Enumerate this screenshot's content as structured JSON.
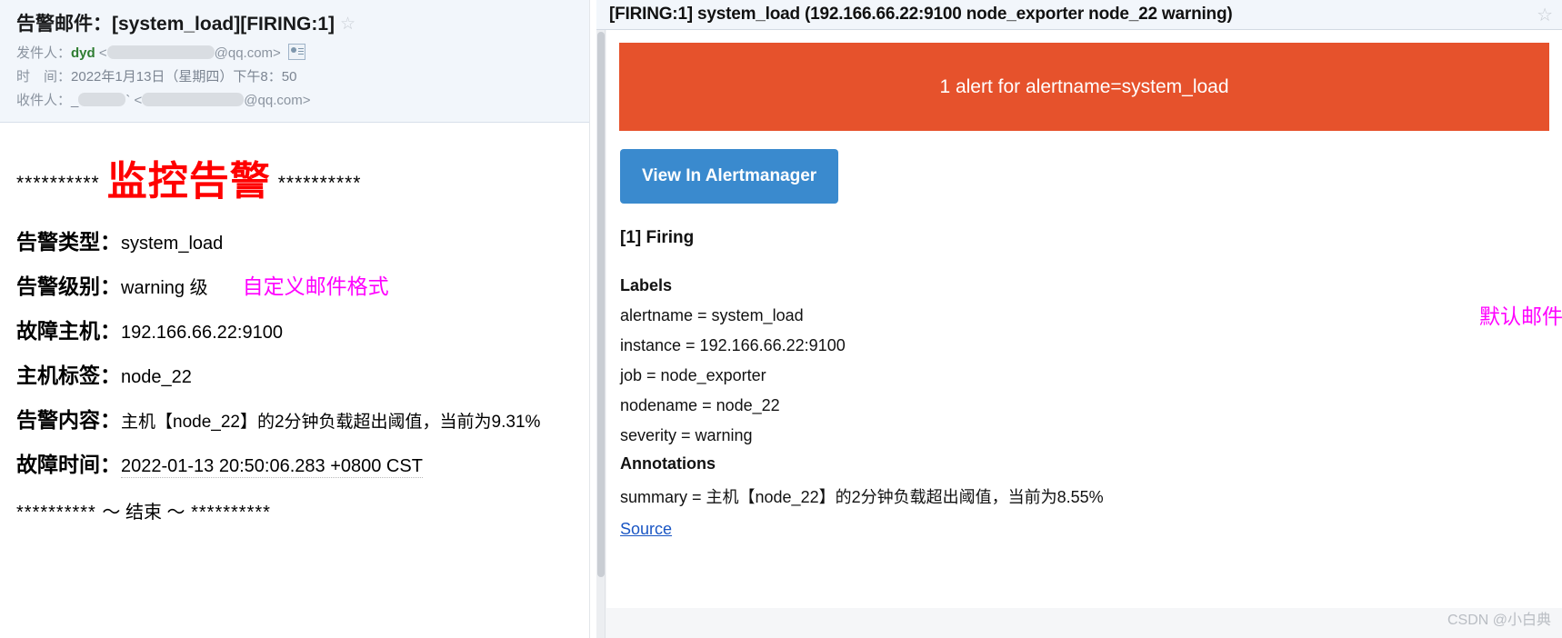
{
  "left_mail": {
    "subject": "告警邮件：[system_load][FIRING:1]",
    "star_glyph": "☆",
    "from_label": "发件人：",
    "from_name": "dyd",
    "from_domain": "@qq.com>",
    "angle_open": "<",
    "time_label": "时　间：",
    "time_value": "2022年1月13日（星期四）下午8：50",
    "to_label": "收件人：",
    "to_prefix": "_",
    "to_suffix": "`",
    "to_domain": "@qq.com>",
    "body": {
      "stars_left": "**********",
      "title": "监控告警",
      "stars_right": "**********",
      "fields": [
        {
          "key": "告警类型：",
          "value": "system_load"
        },
        {
          "key": "告警级别：",
          "value": "warning 级",
          "annotation": "自定义邮件格式"
        },
        {
          "key": "故障主机：",
          "value": "192.166.66.22:9100"
        },
        {
          "key": "主机标签：",
          "value": "node_22"
        },
        {
          "key": "告警内容：",
          "value": "主机【node_22】的2分钟负载超出阈值，当前为9.31%"
        },
        {
          "key": "故障时间：",
          "value": "2022-01-13 20:50:06.283 +0800 CST"
        }
      ],
      "end_stars_left": "**********",
      "end_mid": "～ 结束 ～",
      "end_stars_right": "**********"
    }
  },
  "right_mail": {
    "subject": "[FIRING:1] system_load (192.166.66.22:9100 node_exporter node_22 warning)",
    "star_glyph": "☆",
    "banner_text": "1 alert for alertname=system_load",
    "banner_color": "#e6522c",
    "button_label": "View In Alertmanager",
    "button_color": "#3a8ace",
    "firing_heading": "[1] Firing",
    "labels_heading": "Labels",
    "labels": [
      "alertname = system_load",
      "instance = 192.166.66.22:9100",
      "job = node_exporter",
      "nodename = node_22",
      "severity = warning"
    ],
    "annotations_heading": "Annotations",
    "annotations": [
      "summary = 主机【node_22】的2分钟负载超出阈值，当前为8.55%"
    ],
    "source_label": "Source",
    "annotation_note": "默认邮件格式"
  },
  "watermark": "CSDN @小白典"
}
